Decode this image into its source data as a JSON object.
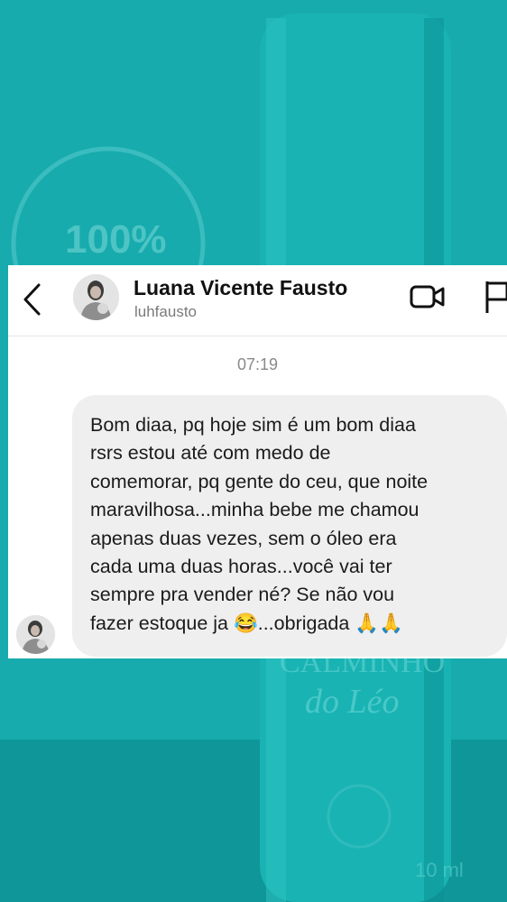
{
  "contact": {
    "name": "Luana Vicente Fausto",
    "username": "luhfausto"
  },
  "icons": {
    "back": "chevron-left-icon",
    "video": "video-camera-icon",
    "flag": "flag-icon"
  },
  "conversation": {
    "timestamp": "07:19",
    "message_lines": [
      "Bom diaa, pq hoje sim é um bom diaa",
      "rsrs estou até com medo de",
      "comemorar, pq gente do ceu, que noite",
      "maravilhosa...minha bebe me chamou",
      "apenas duas vezes, sem o óleo era",
      "cada uma duas horas...você vai ter",
      "sempre pra vender né? Se não vou",
      "fazer estoque ja 😂...obrigada 🙏🙏"
    ]
  },
  "background": {
    "badge_text": "100%",
    "product_text_1": "CALMINHO",
    "product_text_2": "do Léo",
    "volume_text": "10 ml"
  },
  "colors": {
    "teal_background": "#15a6a8",
    "bubble": "#efefef"
  }
}
